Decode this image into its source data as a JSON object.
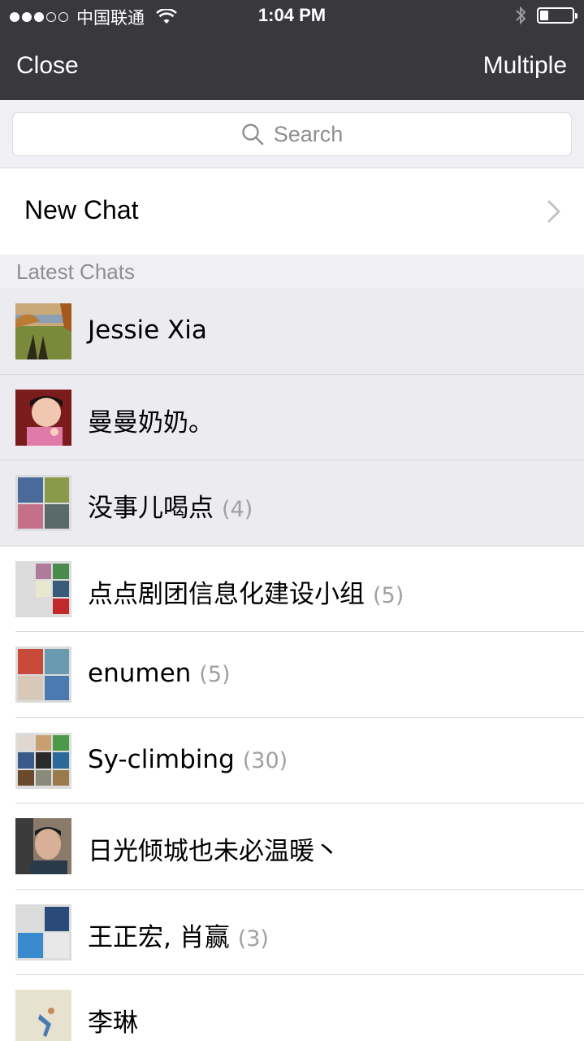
{
  "status_bar": {
    "carrier": "中国联通",
    "time": "1:04 PM",
    "signal_bars": 3,
    "signal_total": 5,
    "battery_level": 0.25
  },
  "nav": {
    "close_label": "Close",
    "multiple_label": "Multiple"
  },
  "search": {
    "placeholder": "Search"
  },
  "new_chat": {
    "label": "New Chat"
  },
  "section": {
    "latest_chats": "Latest Chats"
  },
  "chats": [
    {
      "name": "Jessie Xia",
      "count": ""
    },
    {
      "name": "曼曼奶奶。",
      "count": ""
    },
    {
      "name": "没事儿喝点",
      "count": "(4)"
    },
    {
      "name": "点点剧团信息化建设小组",
      "count": "(5)"
    },
    {
      "name": "enumen",
      "count": "(5)"
    },
    {
      "name": "Sy-climbing",
      "count": "(30)"
    },
    {
      "name": "日光倾城也未必温暖丶",
      "count": ""
    },
    {
      "name": "王正宏, 肖赢",
      "count": "(3)"
    },
    {
      "name": "李琳",
      "count": ""
    }
  ],
  "colors": {
    "nav_bg": "#38383d",
    "group_bg": "#efeff4",
    "selected_row": "#ebebf0",
    "secondary_text": "#8e8e93"
  }
}
